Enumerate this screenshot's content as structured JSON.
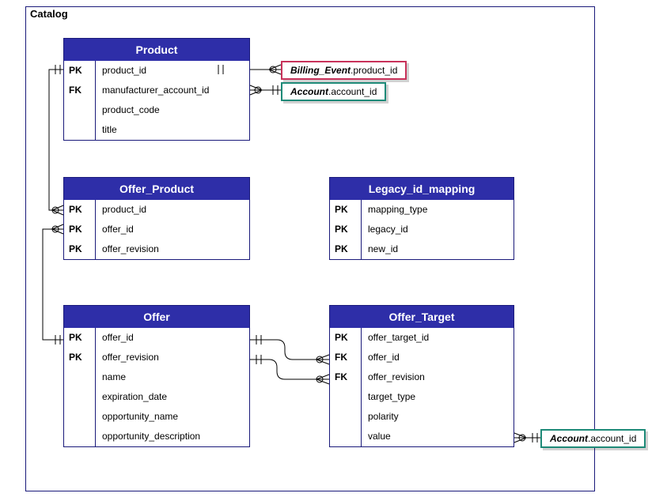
{
  "container": {
    "label": "Catalog"
  },
  "entities": {
    "product": {
      "title": "Product",
      "rows": [
        {
          "key": "PK",
          "name": "product_id"
        },
        {
          "key": "FK",
          "name": "manufacturer_account_id"
        },
        {
          "key": "",
          "name": "product_code"
        },
        {
          "key": "",
          "name": "title"
        }
      ]
    },
    "offer_product": {
      "title": "Offer_Product",
      "rows": [
        {
          "key": "PK",
          "name": "product_id"
        },
        {
          "key": "PK",
          "name": "offer_id"
        },
        {
          "key": "PK",
          "name": "offer_revision"
        }
      ]
    },
    "legacy_id_mapping": {
      "title": "Legacy_id_mapping",
      "rows": [
        {
          "key": "PK",
          "name": "mapping_type"
        },
        {
          "key": "PK",
          "name": "legacy_id"
        },
        {
          "key": "PK",
          "name": "new_id"
        }
      ]
    },
    "offer": {
      "title": "Offer",
      "rows": [
        {
          "key": "PK",
          "name": "offer_id"
        },
        {
          "key": "PK",
          "name": "offer_revision"
        },
        {
          "key": "",
          "name": "name"
        },
        {
          "key": "",
          "name": "expiration_date"
        },
        {
          "key": "",
          "name": "opportunity_name"
        },
        {
          "key": "",
          "name": "opportunity_description"
        }
      ]
    },
    "offer_target": {
      "title": "Offer_Target",
      "rows": [
        {
          "key": "PK",
          "name": "offer_target_id"
        },
        {
          "key": "FK",
          "name": "offer_id"
        },
        {
          "key": "FK",
          "name": "offer_revision"
        },
        {
          "key": "",
          "name": "target_type"
        },
        {
          "key": "",
          "name": "polarity"
        },
        {
          "key": "",
          "name": "value"
        }
      ]
    }
  },
  "refs": {
    "billing_event": {
      "entity": "Billing_Event",
      "attr": ".product_id"
    },
    "account1": {
      "entity": "Account",
      "attr": ".account_id"
    },
    "account2": {
      "entity": "Account",
      "attr": ".account_id"
    }
  }
}
